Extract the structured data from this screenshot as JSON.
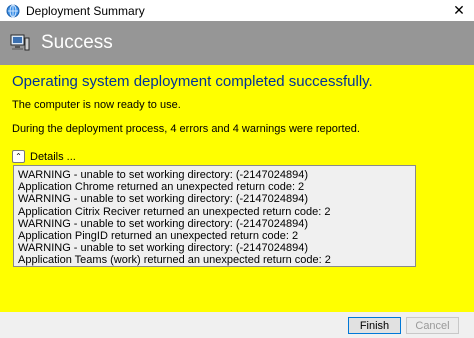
{
  "window": {
    "title": "Deployment Summary",
    "close_glyph": "✕"
  },
  "banner": {
    "title": "Success",
    "color": "#969696"
  },
  "content": {
    "background": "#ffff00",
    "headline": "Operating system deployment completed successfully.",
    "ready_text": "The computer is now ready to use.",
    "process_text": "During the deployment process, 4 errors and 4 warnings were reported.",
    "details_label": "Details ...",
    "log_lines": [
      "WARNING - unable to set working directory:  (-2147024894)",
      "Application Chrome returned an unexpected return code: 2",
      "WARNING - unable to set working directory:  (-2147024894)",
      "Application Citrix Reciver returned an unexpected return code: 2",
      "WARNING - unable to set working directory:  (-2147024894)",
      "Application PingID returned an unexpected return code: 2",
      "WARNING - unable to set working directory:  (-2147024894)",
      "Application Teams (work) returned an unexpected return code: 2"
    ]
  },
  "footer": {
    "finish_label": "Finish",
    "cancel_label": "Cancel"
  },
  "icons": {
    "app": "deployment-icon",
    "banner": "computer-icon",
    "details": "chevron-up-icon"
  }
}
